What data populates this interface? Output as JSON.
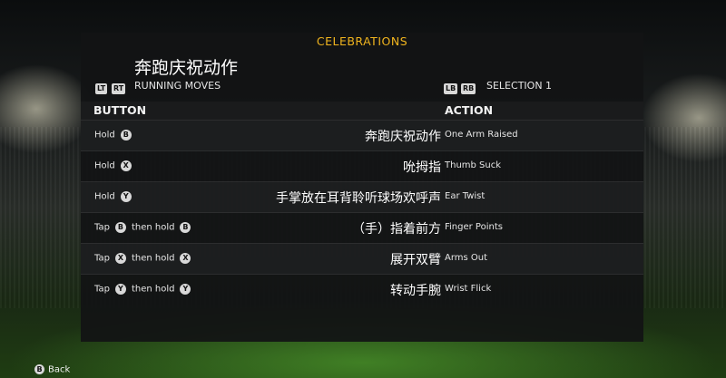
{
  "title": "CELEBRATIONS",
  "big_caption": "奔跑庆祝动作",
  "left_selector": {
    "triggers": [
      "LT",
      "RT"
    ],
    "label": "RUNNING MOVES",
    "pips_total": 3,
    "pips_active": 1
  },
  "right_selector": {
    "bumpers": [
      "LB",
      "RB"
    ],
    "label": "SELECTION 1",
    "pips_total": 3,
    "pips_active": 1
  },
  "columns": {
    "button": "BUTTON",
    "action": "ACTION"
  },
  "rows": [
    {
      "verb1": "Hold",
      "btn1": "B",
      "then": "",
      "btn2": "",
      "chinese": "奔跑庆祝动作",
      "action": "One Arm Raised"
    },
    {
      "verb1": "Hold",
      "btn1": "X",
      "then": "",
      "btn2": "",
      "chinese": "吮拇指",
      "action": "Thumb Suck"
    },
    {
      "verb1": "Hold",
      "btn1": "Y",
      "then": "",
      "btn2": "",
      "chinese": "手掌放在耳背聆听球场欢呼声",
      "action": "Ear Twist"
    },
    {
      "verb1": "Tap",
      "btn1": "B",
      "then": "then hold",
      "btn2": "B",
      "chinese": "（手）指着前方",
      "action": "Finger Points"
    },
    {
      "verb1": "Tap",
      "btn1": "X",
      "then": "then hold",
      "btn2": "X",
      "chinese": "展开双臂",
      "action": "Arms Out"
    },
    {
      "verb1": "Tap",
      "btn1": "Y",
      "then": "then hold",
      "btn2": "Y",
      "chinese": "转动手腕",
      "action": "Wrist Flick"
    }
  ],
  "footer": {
    "back_button": "B",
    "back_label": "Back"
  },
  "colors": {
    "accent": "#f0b41e",
    "panel": "#121314"
  }
}
